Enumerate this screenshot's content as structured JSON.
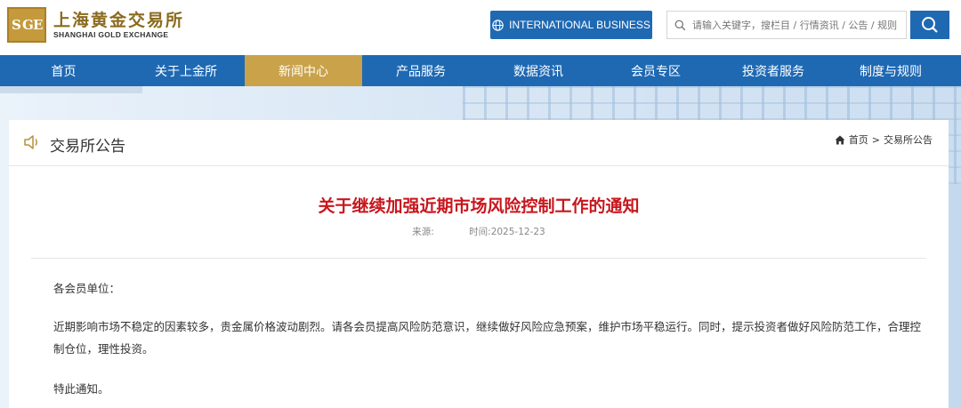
{
  "logo": {
    "mark": [
      "S",
      "G",
      "E"
    ],
    "cn": "上海黄金交易所",
    "en": "SHANGHAI GOLD EXCHANGE"
  },
  "header": {
    "intl_button": "INTERNATIONAL BUSINESS",
    "search_placeholder": "请输入关键字，搜栏目 / 行情资讯 / 公告 / 规则"
  },
  "nav": {
    "items": [
      "首页",
      "关于上金所",
      "新闻中心",
      "产品服务",
      "数据资讯",
      "会员专区",
      "投资者服务",
      "制度与规则"
    ],
    "active_index": 2
  },
  "section": {
    "title": "交易所公告",
    "breadcrumb": [
      "首页",
      ">",
      "交易所公告"
    ]
  },
  "article": {
    "title": "关于继续加强近期市场风险控制工作的通知",
    "source_label": "来源:",
    "time_label": "时间:2025-12-23",
    "greeting": "各会员单位：",
    "paragraph": "近期影响市场不稳定的因素较多，贵金属价格波动剧烈。请各会员提高风险防范意识，继续做好风险应急预案，维护市场平稳运行。同时，提示投资者做好风险防范工作，合理控制仓位，理性投资。",
    "closing": "特此通知。"
  },
  "colors": {
    "brand_blue": "#1f69b3",
    "active_gold": "#c9a24a",
    "title_red": "#c8161d"
  }
}
